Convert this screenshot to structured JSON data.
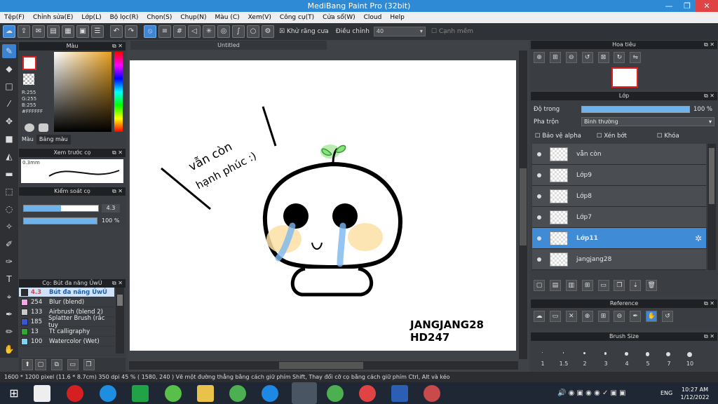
{
  "window": {
    "title": "MediBang Paint Pro (32bit)",
    "min": "—",
    "max": "❐",
    "close": "✕"
  },
  "menu": [
    "Tệp(F)",
    "Chỉnh sửa(E)",
    "Lớp(L)",
    "Bộ lọc(R)",
    "Chọn(S)",
    "Chụp(N)",
    "Màu (C)",
    "Xem(V)",
    "Công cụ(T)",
    "Cửa sổ(W)",
    "Cloud",
    "Help"
  ],
  "toolbar": {
    "antialias": "Khử răng cưa",
    "adjust": "Điều chỉnh",
    "adjust_value": "40",
    "sharp": "Cạnh mềm"
  },
  "color_panel": {
    "title": "Màu",
    "r": "R:255",
    "g": "G:255",
    "b": "B:255",
    "hex": "#FFFFFF",
    "tab1": "Màu",
    "tab2": "Bảng màu"
  },
  "preview_panel": {
    "title": "Xem trước cọ",
    "size": "0.3mm"
  },
  "brush_control": {
    "title": "Kiểm soát cọ",
    "size": "4.3",
    "opacity": "100 %",
    "size_fill": 0.5,
    "opacity_fill": 1.0
  },
  "brush_panel": {
    "title": "Cọ: Bút đa năng ỦwÚ",
    "items": [
      {
        "size": "4.3",
        "name": "Bút đa năng ỦwÚ",
        "color": "#2a2c2f",
        "sel": true
      },
      {
        "size": "254",
        "name": "Blur (blend)",
        "color": "#f0a8e8",
        "sel": false
      },
      {
        "size": "133",
        "name": "Airbrush (blend 2)",
        "color": "#c8c8c8",
        "sel": false
      },
      {
        "size": "185",
        "name": "Splatter Brush (rắc tuy",
        "color": "#3a56d8",
        "sel": false
      },
      {
        "size": "13",
        "name": "Tt calligraphy",
        "color": "#2eaa2e",
        "sel": false
      },
      {
        "size": "100",
        "name": "Watercolor (Wet)",
        "color": "#7fd4f0",
        "sel": false
      }
    ]
  },
  "canvas": {
    "tab": "Untitled",
    "text1": "vẫn còn",
    "text2": "hạnh phúc :)",
    "sig1": "JANGJANG28",
    "sig2": "HD247"
  },
  "navigator": {
    "title": "Hoa tiêu"
  },
  "layer_panel": {
    "title": "Lớp",
    "opacity_label": "Độ trong",
    "opacity_value": "100 %",
    "blend_label": "Pha trộn",
    "blend_value": "Bình thường",
    "alpha": "Bảo vệ alpha",
    "clip": "Xén bớt",
    "lock": "Khóa",
    "layers": [
      {
        "name": "vẫn còn",
        "sel": false
      },
      {
        "name": "Lớp9",
        "sel": false
      },
      {
        "name": "Lớp8",
        "sel": false
      },
      {
        "name": "Lớp7",
        "sel": false
      },
      {
        "name": "Lớp11",
        "sel": true
      },
      {
        "name": "jangjang28",
        "sel": false
      }
    ]
  },
  "reference": {
    "title": "Reference"
  },
  "brush_size": {
    "title": "Brush Size",
    "sizes": [
      "1",
      "1.5",
      "2",
      "3",
      "4",
      "5",
      "7",
      "10"
    ]
  },
  "status": "1600 * 1200 pixel   (11.6 * 8.7cm)   350 dpi   45 %   ( 1580, 240 )   Vẽ một đường thẳng bằng cách giữ phím Shift, Thay đổi cỡ cọ bằng cách giữ phím Ctrl, Alt và kéo",
  "taskbar": {
    "lang": "ENG",
    "time": "10:27 AM",
    "date": "1/12/2022"
  }
}
